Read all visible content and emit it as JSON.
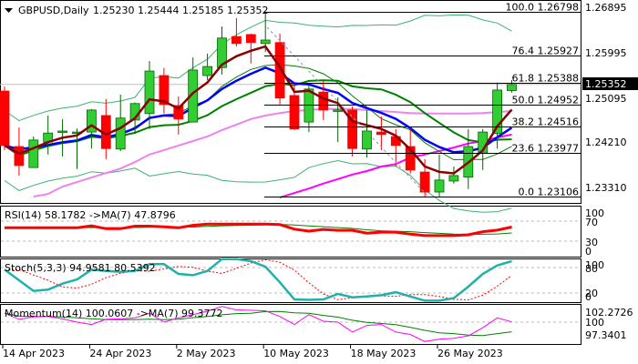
{
  "header": {
    "symbol": "GBPUSD,Daily",
    "ohlc_text": "1.25230 1.25444 1.25185 1.25352"
  },
  "colors": {
    "bull": "#32cd32",
    "bull_border": "#006400",
    "bear": "#ff0000",
    "ema_fast": "#8b0000",
    "ema_mid": "#0000ff",
    "sma_green": "#008000",
    "band": "#3cb371",
    "violet_ma": "#ee82ee",
    "magenta_ma": "#ff00ff",
    "rsi": "#ff0000",
    "stoch_k": "#20b2aa",
    "momentum": "#ff00ff"
  },
  "chart_data": {
    "type": "candlestick",
    "title": "GBPUSD,Daily",
    "ylim": [
      1.23,
      1.2705
    ],
    "price_axis": [
      "1.26895",
      "1.25995",
      "1.25095",
      "1.24210",
      "1.23310"
    ],
    "current_price": "1.25352",
    "x_tick_labels": [
      {
        "bar": 0,
        "label": "14 Apr 2023"
      },
      {
        "bar": 6,
        "label": "24 Apr 2023"
      },
      {
        "bar": 12,
        "label": "2 May 2023"
      },
      {
        "bar": 18,
        "label": "10 May 2023"
      },
      {
        "bar": 24,
        "label": "18 May 2023"
      },
      {
        "bar": 30,
        "label": "26 May 2023"
      }
    ],
    "ohlc": [
      [
        1.2522,
        1.2531,
        1.2404,
        1.2413
      ],
      [
        1.2411,
        1.2449,
        1.2353,
        1.2373
      ],
      [
        1.2369,
        1.2431,
        1.2369,
        1.2424
      ],
      [
        1.242,
        1.2473,
        1.2395,
        1.2438
      ],
      [
        1.244,
        1.2466,
        1.2391,
        1.2442
      ],
      [
        1.2438,
        1.2447,
        1.2366,
        1.244
      ],
      [
        1.244,
        1.2486,
        1.2407,
        1.2484
      ],
      [
        1.2473,
        1.2506,
        1.2386,
        1.2407
      ],
      [
        1.2406,
        1.2515,
        1.2402,
        1.2468
      ],
      [
        1.2464,
        1.2499,
        1.2437,
        1.2497
      ],
      [
        1.2477,
        1.2582,
        1.2446,
        1.2562
      ],
      [
        1.2553,
        1.2568,
        1.2477,
        1.2495
      ],
      [
        1.2493,
        1.2511,
        1.2435,
        1.2466
      ],
      [
        1.246,
        1.2589,
        1.246,
        1.2564
      ],
      [
        1.2553,
        1.2597,
        1.2544,
        1.2571
      ],
      [
        1.2569,
        1.2651,
        1.2555,
        1.2628
      ],
      [
        1.2631,
        1.2668,
        1.2611,
        1.2617
      ],
      [
        1.2635,
        1.2637,
        1.2577,
        1.2619
      ],
      [
        1.2617,
        1.268,
        1.26,
        1.2624
      ],
      [
        1.2619,
        1.2637,
        1.2495,
        1.2508
      ],
      [
        1.2513,
        1.254,
        1.2444,
        1.2446
      ],
      [
        1.246,
        1.2533,
        1.244,
        1.2526
      ],
      [
        1.252,
        1.2542,
        1.2464,
        1.2484
      ],
      [
        1.2482,
        1.2509,
        1.242,
        1.2484
      ],
      [
        1.2484,
        1.2491,
        1.2391,
        1.2407
      ],
      [
        1.2406,
        1.2484,
        1.2389,
        1.2442
      ],
      [
        1.244,
        1.2471,
        1.2404,
        1.2435
      ],
      [
        1.2431,
        1.2446,
        1.2371,
        1.2413
      ],
      [
        1.2411,
        1.2446,
        1.2357,
        1.2364
      ],
      [
        1.236,
        1.2386,
        1.2311,
        1.232
      ],
      [
        1.232,
        1.2395,
        1.2311,
        1.2344
      ],
      [
        1.2342,
        1.2371,
        1.2337,
        1.2353
      ],
      [
        1.235,
        1.2446,
        1.2326,
        1.2411
      ],
      [
        1.2398,
        1.2446,
        1.2364,
        1.244
      ],
      [
        1.2437,
        1.2539,
        1.2407,
        1.2524
      ],
      [
        1.2523,
        1.2544,
        1.2519,
        1.2535
      ]
    ],
    "violet_ma": [
      null,
      null,
      1.2311,
      1.2316,
      1.2331,
      1.234,
      1.2349,
      1.2358,
      1.2367,
      1.238,
      1.2395,
      1.2404,
      1.2413,
      1.2422,
      1.2431,
      1.2444,
      1.2455,
      1.2466,
      1.2473,
      1.2478,
      1.2482,
      1.2484,
      1.2486,
      1.2486,
      1.2486,
      1.2484,
      1.2482,
      1.248,
      1.2478,
      1.2477,
      1.2477,
      1.2477,
      1.2477,
      1.2478,
      1.248,
      1.2482
    ],
    "magenta_ma": [
      null,
      null,
      null,
      null,
      null,
      null,
      null,
      null,
      null,
      null,
      null,
      null,
      null,
      null,
      null,
      null,
      null,
      null,
      null,
      1.2309,
      1.2318,
      1.2327,
      1.2337,
      1.2346,
      1.2355,
      1.2362,
      1.2371,
      1.2376,
      1.2389,
      1.2395,
      1.2402,
      1.2409,
      1.2417,
      1.2422,
      1.2429,
      1.2435
    ],
    "fibonacci": [
      {
        "level": "100.0",
        "price": "1.26798"
      },
      {
        "level": "76.4",
        "price": "1.25927"
      },
      {
        "level": "61.8",
        "price": "1.25388"
      },
      {
        "level": "50.0",
        "price": "1.24952"
      },
      {
        "level": "38.2",
        "price": "1.24516"
      },
      {
        "level": "23.6",
        "price": "1.23977"
      },
      {
        "level": "0.0",
        "price": "1.23106"
      }
    ],
    "rsi": {
      "label": "RSI(14) 58.1782  ->MA(7) 47.8796",
      "levels": [
        "100",
        "70",
        "30",
        "0"
      ],
      "values": [
        56.7,
        56.7,
        56.7,
        56.7,
        56.7,
        56.7,
        60.5,
        55,
        55,
        60,
        60,
        58.6,
        56.7,
        61.7,
        64,
        64,
        64,
        64,
        64,
        63,
        54,
        50,
        53.5,
        51.6,
        51.6,
        46,
        48,
        48,
        44,
        41,
        41,
        41,
        42.7,
        49,
        52,
        58.18
      ]
    },
    "stoch": {
      "label": "Stoch(5,3,3) 94.9581 80.5392",
      "levels": [
        "100",
        "80",
        "20",
        "0"
      ],
      "k": [
        75,
        50,
        25,
        28,
        42,
        52,
        75,
        72,
        70,
        72,
        88,
        88,
        65,
        62,
        72,
        100,
        100,
        95,
        82,
        45,
        5,
        4,
        5,
        18,
        10,
        12,
        15,
        22,
        12,
        2,
        2,
        8,
        35,
        65,
        85,
        94.96
      ]
    },
    "momentum": {
      "label": "Momentum(14) 100.0607  ->MA(7) 99.3772",
      "levels": [
        "102.2726",
        "100",
        "97.3401"
      ],
      "values": [
        101.9,
        100.6,
        101.1,
        101.2,
        100.7,
        100,
        99.5,
        100.6,
        100.7,
        100.9,
        101.9,
        100,
        100.9,
        101.6,
        102.3,
        103.3,
        102.6,
        102.5,
        102.4,
        101.2,
        99.5,
        101.6,
        100.2,
        100,
        97.9,
        99.3,
        99.5,
        97.9,
        97.4,
        95.9,
        96.4,
        96.6,
        97.1,
        98.8,
        100.9,
        100.06
      ]
    }
  }
}
